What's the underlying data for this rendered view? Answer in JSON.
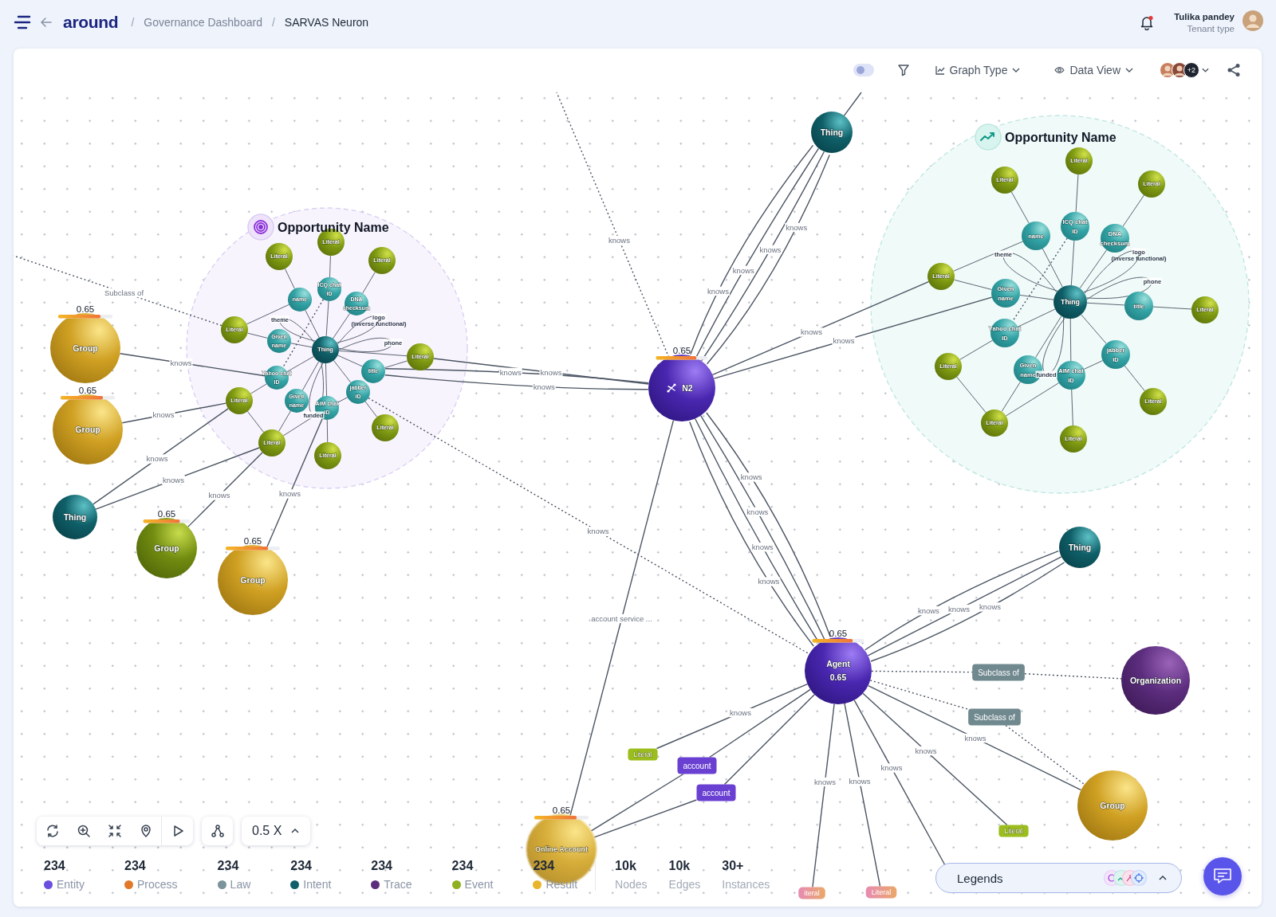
{
  "header": {
    "logo": "around",
    "breadcrumbs": [
      {
        "separator": "/",
        "label": "Governance Dashboard",
        "current": false
      },
      {
        "separator": "/",
        "label": "SARVAS Neuron",
        "current": true
      }
    ],
    "notification": {
      "unread": true
    },
    "user": {
      "name": "Tulika pandey",
      "role": "Tenant type"
    }
  },
  "toolbar": {
    "toggle": {
      "on": false
    },
    "graph_type": "Graph Type",
    "data_view": "Data View",
    "collaborators_more": "+2"
  },
  "graph": {
    "clusters": [
      {
        "title": "Opportunity Name",
        "kind": "target"
      },
      {
        "title": "Opportunity Name",
        "kind": "trend"
      }
    ],
    "nodes": [
      {
        "label": "N2",
        "kind": "neuron",
        "score": "0.65",
        "level": 0.78
      },
      {
        "label": "Agent",
        "sublabel": "0.65",
        "kind": "agent",
        "score": "0.65",
        "level": 0.78
      },
      {
        "label": "Thing",
        "kind": "thing"
      },
      {
        "label": "Thing",
        "kind": "thing"
      },
      {
        "label": "Organization",
        "kind": "organization"
      },
      {
        "label": "Group",
        "kind": "group"
      },
      {
        "label": "Online Account",
        "kind": "group-faded",
        "score": "0.65",
        "level": 0.78
      },
      {
        "label": "Group",
        "kind": "group",
        "score": "0.65",
        "level": 0.78
      },
      {
        "label": "Group",
        "kind": "group",
        "score": "0.65",
        "level": 0.78
      },
      {
        "label": "Thing",
        "kind": "thing"
      },
      {
        "label": "Group",
        "kind": "group-olive",
        "score": "0.65",
        "level": 0.78
      },
      {
        "label": "Group",
        "kind": "group",
        "score": "0.65",
        "level": 0.78
      },
      {
        "label": "Thing",
        "kind": "thing"
      },
      {
        "label": "Literal",
        "kind": "literal"
      },
      {
        "label": "Literal",
        "kind": "literal"
      },
      {
        "label": "Literal",
        "kind": "literal"
      },
      {
        "label": "Literal",
        "kind": "literal"
      },
      {
        "label": "Literal",
        "kind": "literal"
      },
      {
        "label": "Literal",
        "kind": "literal"
      },
      {
        "label": "Literal",
        "kind": "literal"
      },
      {
        "label": "Literal",
        "kind": "literal"
      },
      {
        "label": "Literal",
        "kind": "literal"
      },
      {
        "label": "name",
        "kind": "property"
      },
      {
        "label": "ICQ chat ID",
        "kind": "property"
      },
      {
        "label": "DNA checksum",
        "kind": "property"
      },
      {
        "label": "Given name",
        "kind": "property"
      },
      {
        "label": "Yahoo chat ID",
        "kind": "property"
      },
      {
        "label": "Given name",
        "kind": "property"
      },
      {
        "label": "AIM chat ID",
        "kind": "property"
      },
      {
        "label": "jabber ID",
        "kind": "property"
      },
      {
        "label": "title",
        "kind": "property"
      },
      {
        "label": "Thing",
        "kind": "thing"
      },
      {
        "label": "Literal",
        "kind": "literal"
      },
      {
        "label": "Literal",
        "kind": "literal"
      },
      {
        "label": "Literal",
        "kind": "literal"
      },
      {
        "label": "Literal",
        "kind": "literal"
      },
      {
        "label": "Literal",
        "kind": "literal"
      },
      {
        "label": "Literal",
        "kind": "literal"
      },
      {
        "label": "Literal",
        "kind": "literal"
      },
      {
        "label": "Literal",
        "kind": "literal"
      },
      {
        "label": "Literal",
        "kind": "literal"
      },
      {
        "label": "name",
        "kind": "property"
      },
      {
        "label": "ICQ chat ID",
        "kind": "property"
      },
      {
        "label": "DNA checksum",
        "kind": "property"
      },
      {
        "label": "Given name",
        "kind": "property"
      },
      {
        "label": "title",
        "kind": "property"
      },
      {
        "label": "Yahoo chat ID",
        "kind": "property"
      },
      {
        "label": "Given name",
        "kind": "property"
      },
      {
        "label": "AIM chat ID",
        "kind": "property"
      },
      {
        "label": "jabber ID",
        "kind": "property"
      },
      {
        "label": "Literal",
        "kind": "tag-literal"
      },
      {
        "label": "account",
        "kind": "tag-account"
      },
      {
        "label": "account",
        "kind": "tag-account"
      },
      {
        "label": "Subclass of",
        "kind": "tag-subclass"
      },
      {
        "label": "Subclass of",
        "kind": "tag-subclass"
      },
      {
        "label": "Literal",
        "kind": "tag-literal"
      },
      {
        "label": "iteral",
        "kind": "tag-faded"
      },
      {
        "label": "Literal",
        "kind": "tag-faded"
      }
    ],
    "edge_labels": [
      {
        "text": "knows"
      },
      {
        "text": "knows"
      },
      {
        "text": "knows"
      },
      {
        "text": "knows"
      },
      {
        "text": "knows"
      },
      {
        "text": "knows"
      },
      {
        "text": "knows"
      },
      {
        "text": "knows"
      },
      {
        "text": "knows"
      },
      {
        "text": "knows"
      },
      {
        "text": "knows"
      },
      {
        "text": "knows"
      },
      {
        "text": "knows"
      },
      {
        "text": "knows"
      },
      {
        "text": "knows"
      },
      {
        "text": "account service ..."
      },
      {
        "text": "Subclass of"
      },
      {
        "text": "knows"
      },
      {
        "text": "knows"
      },
      {
        "text": "knows"
      },
      {
        "text": "knows"
      },
      {
        "text": "knows"
      },
      {
        "text": "knows"
      },
      {
        "text": "knows"
      },
      {
        "text": "knows"
      },
      {
        "text": "knows"
      },
      {
        "text": "knows"
      },
      {
        "text": "knows"
      },
      {
        "text": "knows"
      },
      {
        "text": "knows"
      },
      {
        "text": "knows"
      },
      {
        "text": "knows"
      },
      {
        "text": "theme"
      },
      {
        "text": "logo",
        "note": "(inverse functional)"
      },
      {
        "text": "phone"
      },
      {
        "text": "funded"
      },
      {
        "text": "theme"
      },
      {
        "text": "logo",
        "note": "(inverse functional)"
      },
      {
        "text": "phone"
      },
      {
        "text": "funded"
      }
    ]
  },
  "controls": {
    "zoom": "0.5 X"
  },
  "stats": [
    {
      "value": "234",
      "label": "Entity",
      "color": "#6b4fe0"
    },
    {
      "value": "234",
      "label": "Process",
      "color": "#e07a2a"
    },
    {
      "value": "234",
      "label": "Law",
      "color": "#7b939b"
    },
    {
      "value": "234",
      "label": "Intent",
      "color": "#0f5f68"
    },
    {
      "value": "234",
      "label": "Trace",
      "color": "#5c2d7e"
    },
    {
      "value": "234",
      "label": "Event",
      "color": "#8fb021"
    },
    {
      "value": "234",
      "label": "Result",
      "color": "#e8b52a"
    }
  ],
  "totals": [
    {
      "value": "10k",
      "label": "Nodes"
    },
    {
      "value": "10k",
      "label": "Edges"
    },
    {
      "value": "30+",
      "label": "Instances"
    }
  ],
  "legends": {
    "title": "Legends"
  }
}
